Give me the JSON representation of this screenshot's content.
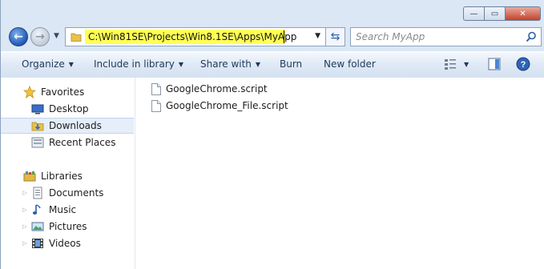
{
  "window": {
    "caption_buttons": {
      "minimize": "—",
      "maximize": "▭",
      "close": "✕"
    }
  },
  "navigation": {
    "address": "C:\\Win81SE\\Projects\\Win8.1SE\\Apps\\MyApp",
    "search_placeholder": "Search MyApp",
    "address_highlight_color": "#ffff55"
  },
  "toolbar": {
    "organize": "Organize",
    "include_in_library": "Include in library",
    "share_with": "Share with",
    "burn": "Burn",
    "new_folder": "New folder"
  },
  "sidebar": {
    "favorites": {
      "label": "Favorites",
      "items": [
        {
          "label": "Desktop",
          "icon": "desktop-icon"
        },
        {
          "label": "Downloads",
          "icon": "downloads-icon",
          "selected": true
        },
        {
          "label": "Recent Places",
          "icon": "recent-places-icon"
        }
      ]
    },
    "libraries": {
      "label": "Libraries",
      "items": [
        {
          "label": "Documents",
          "icon": "documents-icon"
        },
        {
          "label": "Music",
          "icon": "music-icon"
        },
        {
          "label": "Pictures",
          "icon": "pictures-icon"
        },
        {
          "label": "Videos",
          "icon": "videos-icon"
        }
      ]
    }
  },
  "files": [
    {
      "name": "GoogleChrome.script",
      "icon": "file-icon"
    },
    {
      "name": "GoogleChrome_File.script",
      "icon": "file-icon"
    }
  ]
}
